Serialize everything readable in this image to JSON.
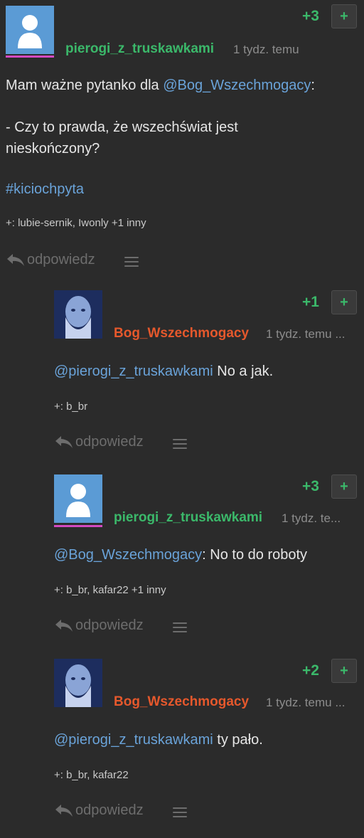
{
  "post": {
    "score": "+3",
    "author": "pierogi_z_truskawkami",
    "time": "1 tydz. temu",
    "line1_prefix": "Mam ważne pytanko dla ",
    "line1_mention": "@Bog_Wszechmogacy",
    "line1_suffix": ":",
    "line2": "- Czy to prawda, że wszechświat jest",
    "line3": "nieskończony?",
    "hashtag": "#kiciochpyta",
    "voters": "+: lubie-sernik, Iwonly +1 inny",
    "reply": "odpowiedz"
  },
  "comments": [
    {
      "score": "+1",
      "author": "Bog_Wszechmogacy",
      "time": "1 tydz. temu ...",
      "mention": "@pierogi_z_truskawkami",
      "text": " No a jak.",
      "voters": "+: b_br",
      "reply": "odpowiedz"
    },
    {
      "score": "+3",
      "author": "pierogi_z_truskawkami",
      "time": "1 tydz. te...",
      "mention": "@Bog_Wszechmogacy",
      "text": ": No to do roboty",
      "voters": "+: b_br, kafar22 +1 inny",
      "reply": "odpowiedz"
    },
    {
      "score": "+2",
      "author": "Bog_Wszechmogacy",
      "time": "1 tydz. temu ...",
      "mention": "@pierogi_z_truskawkami",
      "text": " ty pało.",
      "voters": "+: b_br, kafar22",
      "reply": "odpowiedz"
    }
  ],
  "vote_plus_label": "+",
  "colors": {
    "background": "#2b2b2b",
    "green": "#3bb86a",
    "orange": "#e5582c",
    "link": "#6aa3d9",
    "muted": "#6d6d6d"
  }
}
